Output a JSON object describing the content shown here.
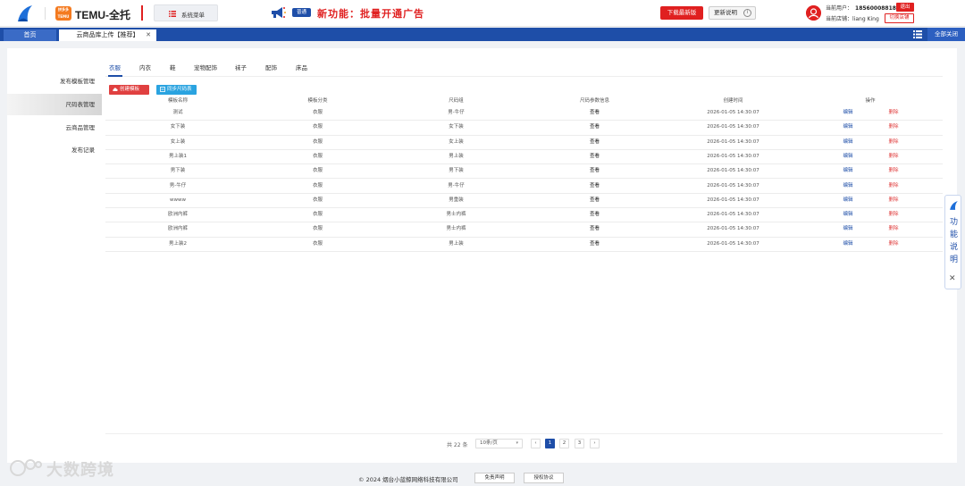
{
  "header": {
    "temu_badge": "拼多多TEMU",
    "brand": "TEMU-全托",
    "system_menu_label": "系统菜单",
    "announce_tag": "普通",
    "announce_text": "新功能：批量开通广告",
    "download_label": "下载最新版",
    "update_notes_label": "更新说明",
    "user_label": "当前用户：",
    "user_phone": "18560008818",
    "store_label": "当前店铺：",
    "store_name": "liang King",
    "logout_label": "退出",
    "switch_store_label": "切换店铺",
    "accent": "#1e4ea8",
    "red": "#e02020"
  },
  "tabs": {
    "home": "首页",
    "active": "云商品库上传【推荐】",
    "close_all": "全部关闭"
  },
  "sidebar": {
    "items": [
      {
        "label": "发布模板管理"
      },
      {
        "label": "尺码表管理"
      },
      {
        "label": "云商品管理"
      },
      {
        "label": "发布记录"
      }
    ]
  },
  "categories": [
    "衣服",
    "内衣",
    "鞋",
    "宠物配饰",
    "袜子",
    "配饰",
    "床品"
  ],
  "actions": {
    "create": "创建模板",
    "sync": "同步尺码表"
  },
  "table": {
    "headers": [
      "模板名称",
      "模板分类",
      "尺码组",
      "尺码参数信息",
      "创建时间",
      "操作"
    ],
    "rows": [
      [
        "测试",
        "衣服",
        "男-牛仔",
        "查看",
        "2026-01-05 14:30:07",
        "编辑",
        "删除"
      ],
      [
        "女下装",
        "衣服",
        "女下装",
        "查看",
        "2026-01-05 14:30:07",
        "编辑",
        "删除"
      ],
      [
        "女上装",
        "衣服",
        "女上装",
        "查看",
        "2026-01-05 14:30:07",
        "编辑",
        "删除"
      ],
      [
        "男上装1",
        "衣服",
        "男上装",
        "查看",
        "2026-01-05 14:30:07",
        "编辑",
        "删除"
      ],
      [
        "男下装",
        "衣服",
        "男下装",
        "查看",
        "2026-01-05 14:30:07",
        "编辑",
        "删除"
      ],
      [
        "男-牛仔",
        "衣服",
        "男-牛仔",
        "查看",
        "2026-01-05 14:30:07",
        "编辑",
        "删除"
      ],
      [
        "wwww",
        "衣服",
        "男重装",
        "查看",
        "2026-01-05 14:30:07",
        "编辑",
        "删除"
      ],
      [
        "欧洲内裤",
        "衣服",
        "男士内裤",
        "查看",
        "2026-01-05 14:30:07",
        "编辑",
        "删除"
      ],
      [
        "欧洲内裤",
        "衣服",
        "男士内裤",
        "查看",
        "2026-01-05 14:30:07",
        "编辑",
        "删除"
      ],
      [
        "男上装2",
        "衣服",
        "男上装",
        "查看",
        "2026-01-05 14:30:07",
        "编辑",
        "删除"
      ]
    ]
  },
  "pagination": {
    "total": "共 22 条",
    "page_size": "10条/页",
    "pages": [
      "1",
      "2",
      "3"
    ],
    "prev": "‹",
    "next": "›"
  },
  "feature_panel": {
    "label": "功能说明",
    "close": "✕"
  },
  "footer": {
    "copyright": "© 2024 烟台小蓝鲸网络科技有限公司",
    "disclaimer": "免责声明",
    "license": "授权协议"
  },
  "watermark": "大数跨境"
}
